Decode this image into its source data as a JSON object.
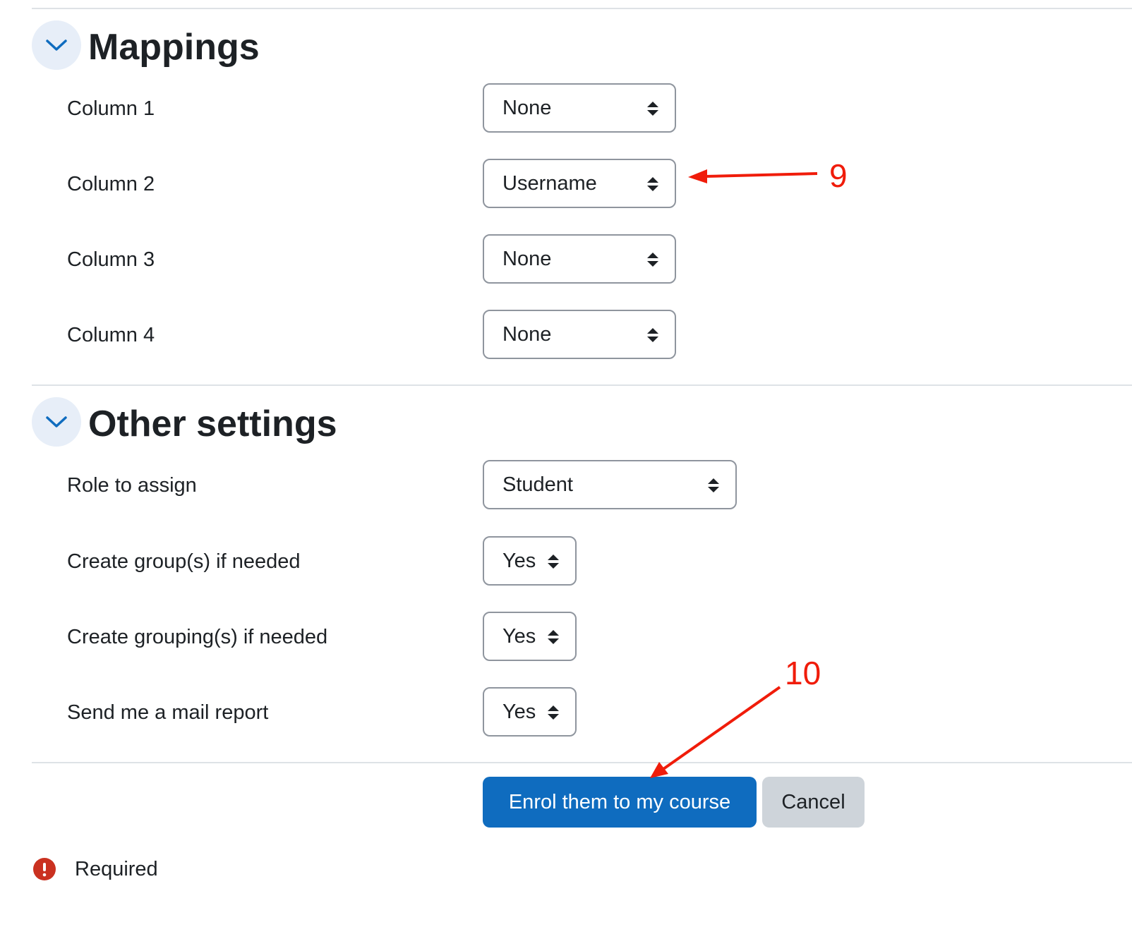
{
  "sections": {
    "mappings": {
      "title": "Mappings",
      "rows": [
        {
          "label": "Column 1",
          "value": "None"
        },
        {
          "label": "Column 2",
          "value": "Username"
        },
        {
          "label": "Column 3",
          "value": "None"
        },
        {
          "label": "Column 4",
          "value": "None"
        }
      ]
    },
    "other": {
      "title": "Other settings",
      "rows": [
        {
          "label": "Role to assign",
          "value": "Student"
        },
        {
          "label": "Create group(s) if needed",
          "value": "Yes"
        },
        {
          "label": "Create grouping(s) if needed",
          "value": "Yes"
        },
        {
          "label": "Send me a mail report",
          "value": "Yes"
        }
      ]
    }
  },
  "buttons": {
    "submit": "Enrol them to my course",
    "cancel": "Cancel"
  },
  "required_label": "Required",
  "annotations": {
    "mapping_step": "9",
    "submit_step": "10"
  },
  "colors": {
    "primary": "#0f6cbf",
    "annotation": "#f01c0a",
    "required_icon": "#ca3120"
  },
  "icons": {
    "section_toggle": "chevron-down-icon",
    "select_caret": "sort-caret-icon",
    "required": "exclamation-circle-icon"
  }
}
